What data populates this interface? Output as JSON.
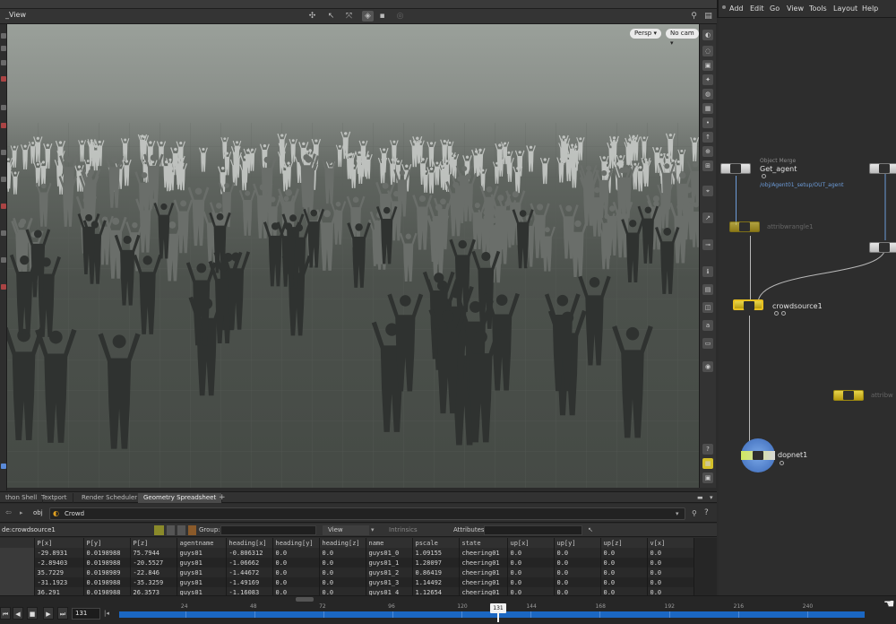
{
  "viewport": {
    "title": "_View",
    "persp_label": "Persp ▾",
    "cam_label": "No cam ▾"
  },
  "bottom_tabs": [
    "thon Shell",
    "Textport",
    "Render Scheduler",
    "Geometry Spreadsheet"
  ],
  "path_bar": {
    "obj_label": "obj",
    "node_label": "Crowd"
  },
  "spreadsheet": {
    "node_label": "de:crowdsource1",
    "group_label": "Group:",
    "view_label": "View",
    "intrinsics_label": "Intrinsics",
    "attributes_label": "Attributes:",
    "columns": [
      "",
      "P[x]",
      "P[y]",
      "P[z]",
      "agentname",
      "heading[x]",
      "heading[y]",
      "heading[z]",
      "name",
      "pscale",
      "state",
      "up[x]",
      "up[y]",
      "up[z]",
      "v[x]"
    ],
    "rows": [
      [
        "",
        "-29.8931",
        "0.0198988",
        "75.7944",
        "guys01",
        "-0.806312",
        "0.0",
        "0.0",
        "guys01_0",
        "1.09155",
        "cheering01",
        "0.0",
        "0.0",
        "0.0",
        "0.0"
      ],
      [
        "",
        "-2.89403",
        "0.0198988",
        "-20.5527",
        "guys01",
        "-1.06662",
        "0.0",
        "0.0",
        "guys01_1",
        "1.28097",
        "cheering01",
        "0.0",
        "0.0",
        "0.0",
        "0.0"
      ],
      [
        "",
        "35.7229",
        "0.0198989",
        "-22.846",
        "guys01",
        "-1.44672",
        "0.0",
        "0.0",
        "guys01_2",
        "0.86419",
        "cheering01",
        "0.0",
        "0.0",
        "0.0",
        "0.0"
      ],
      [
        "",
        "-31.1923",
        "0.0198988",
        "-35.3259",
        "guys01",
        "-1.49169",
        "0.0",
        "0.0",
        "guys01_3",
        "1.14492",
        "cheering01",
        "0.0",
        "0.0",
        "0.0",
        "0.0"
      ],
      [
        "",
        "36.291",
        "0.0198988",
        "26.3573",
        "guys01",
        "-1.16083",
        "0.0",
        "0.0",
        "guys01_4",
        "1.12654",
        "cheering01",
        "0.0",
        "0.0",
        "0.0",
        "0.0"
      ]
    ]
  },
  "timeline": {
    "current_frame": "131",
    "cursor_label": "131",
    "ticks": [
      "24",
      "48",
      "72",
      "96",
      "120",
      "144",
      "168",
      "192",
      "216",
      "240"
    ]
  },
  "network": {
    "menu": [
      "Add",
      "Edit",
      "Go",
      "View",
      "Tools",
      "Layout",
      "Help"
    ],
    "object_merge_type": "Object Merge",
    "get_agent_label": "Get_agent",
    "get_agent_path": "/obj/Agent01_setup/OUT_agent",
    "attribwrangle_label": "attribwrangle1",
    "crowdsource_label": "crowdsource1",
    "attribw_label": "attribw",
    "dopnet_label": "dopnet1"
  },
  "colors": {
    "timeline_blue": "#1b67c2",
    "node_yellow": "#d4c02a",
    "wire_blue": "#6c9bd8"
  }
}
